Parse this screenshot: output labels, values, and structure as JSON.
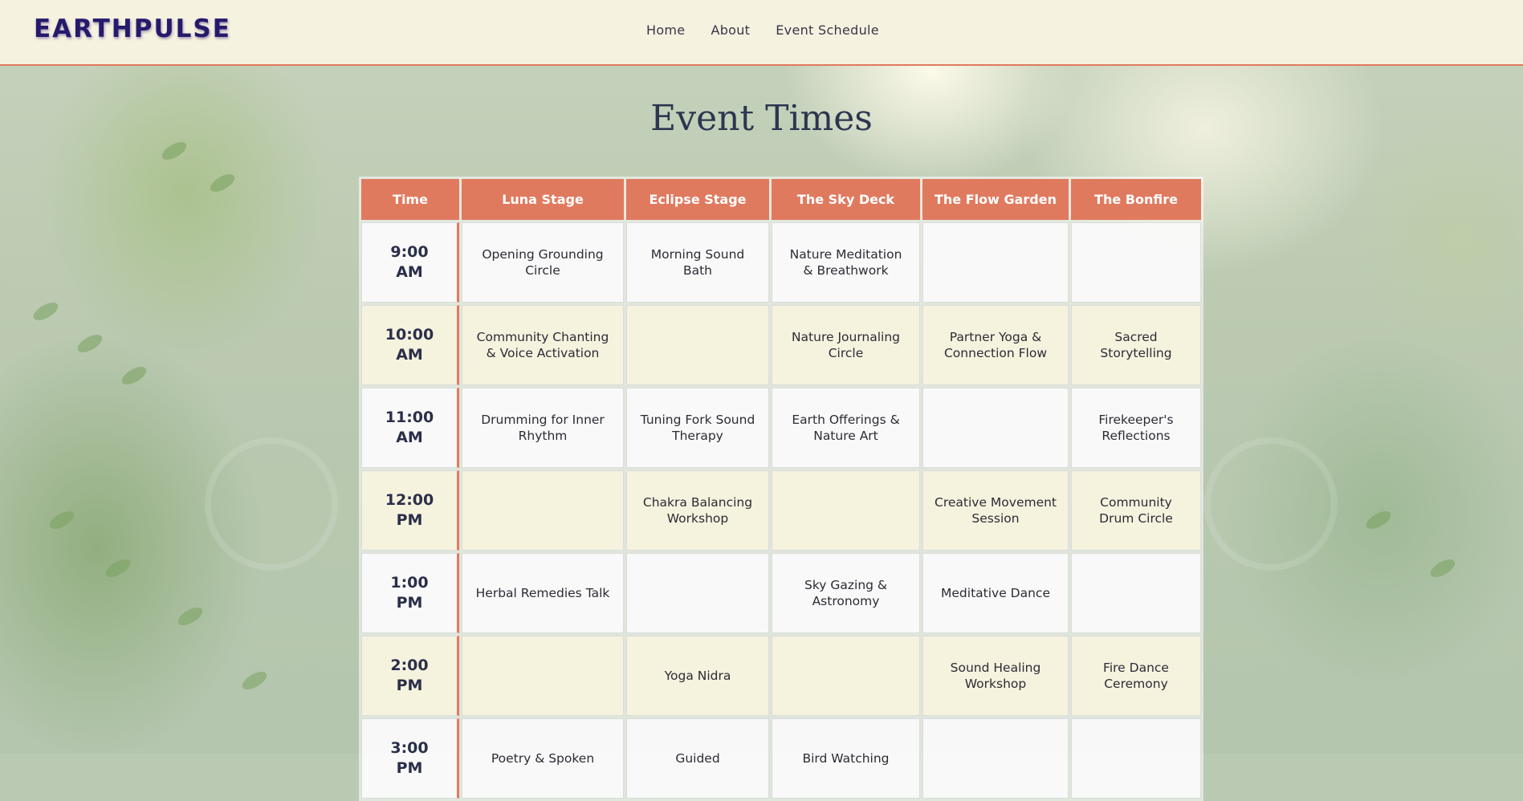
{
  "site": {
    "logo": "EARTHPULSE"
  },
  "nav": {
    "items": [
      "Home",
      "About",
      "Event Schedule"
    ]
  },
  "page": {
    "title": "Event Times"
  },
  "colors": {
    "accent": "#e07a5f",
    "header_bg": "#f6f2e0",
    "logo": "#251a6b",
    "title": "#2c3650"
  },
  "schedule": {
    "headers": [
      "Time",
      "Luna Stage",
      "Eclipse Stage",
      "The Sky Deck",
      "The Flow Garden",
      "The Bonfire"
    ],
    "rows": [
      {
        "time": [
          "9:00",
          "AM"
        ],
        "cells": [
          "Opening Grounding Circle",
          "Morning Sound Bath",
          "Nature Meditation & Breathwork",
          "",
          ""
        ]
      },
      {
        "time": [
          "10:00",
          "AM"
        ],
        "cells": [
          "Community Chanting & Voice Activation",
          "",
          "Nature Journaling Circle",
          "Partner Yoga & Connection Flow",
          "Sacred Storytelling"
        ]
      },
      {
        "time": [
          "11:00",
          "AM"
        ],
        "cells": [
          "Drumming for Inner Rhythm",
          "Tuning Fork Sound Therapy",
          "Earth Offerings & Nature Art",
          "",
          "Firekeeper's Reflections"
        ]
      },
      {
        "time": [
          "12:00",
          "PM"
        ],
        "cells": [
          "",
          "Chakra Balancing Workshop",
          "",
          "Creative Movement Session",
          "Community Drum Circle"
        ]
      },
      {
        "time": [
          "1:00",
          "PM"
        ],
        "cells": [
          "Herbal Remedies Talk",
          "",
          "Sky Gazing & Astronomy",
          "Meditative Dance",
          ""
        ]
      },
      {
        "time": [
          "2:00",
          "PM"
        ],
        "cells": [
          "",
          "Yoga Nidra",
          "",
          "Sound Healing Workshop",
          "Fire Dance Ceremony"
        ]
      },
      {
        "time": [
          "3:00",
          "PM"
        ],
        "cells": [
          "Poetry & Spoken",
          "Guided",
          "Bird Watching",
          "",
          ""
        ]
      }
    ]
  }
}
